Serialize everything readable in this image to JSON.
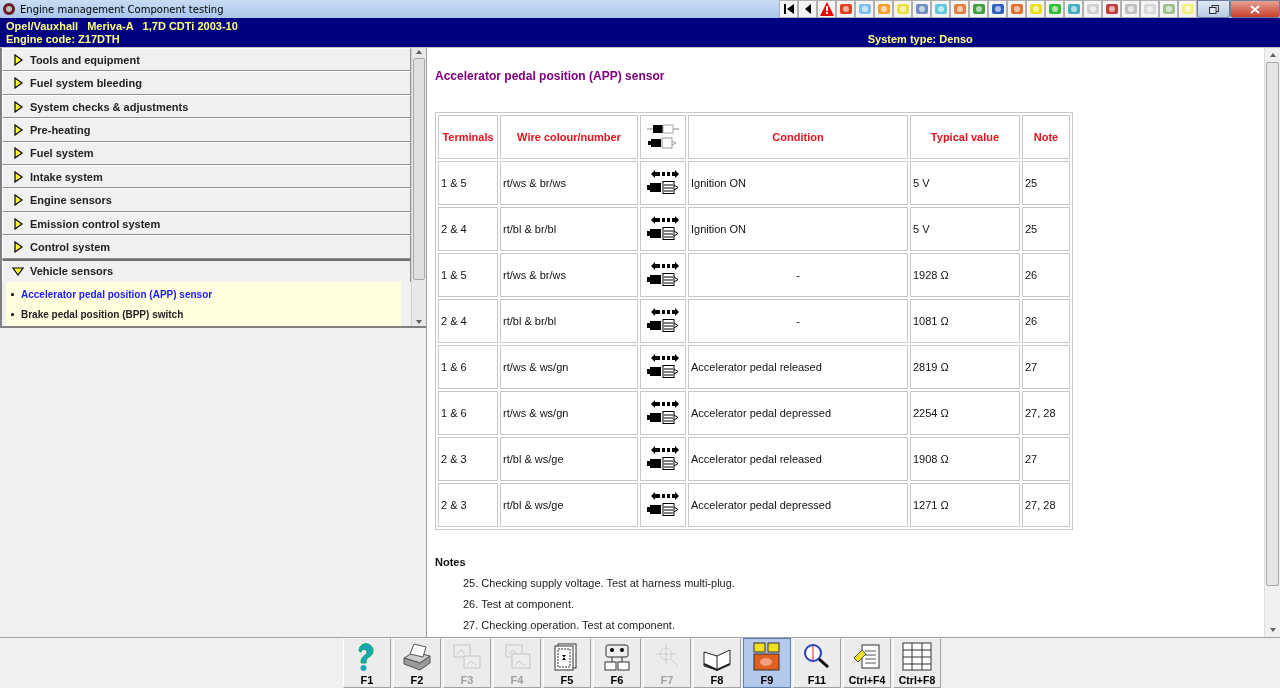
{
  "window": {
    "title": "Engine management Component testing"
  },
  "header": {
    "vehicle": [
      "Opel/Vauxhall",
      "Meriva-A",
      "1,7D CDTi 2003-10"
    ],
    "engine_code": "Engine code: Z17DTH",
    "system_type": "System type: Denso"
  },
  "sidebar": {
    "items": [
      {
        "label": "Tools and equipment",
        "expanded": false
      },
      {
        "label": "Fuel system bleeding",
        "expanded": false
      },
      {
        "label": "System checks & adjustments",
        "expanded": false
      },
      {
        "label": "Pre-heating",
        "expanded": false
      },
      {
        "label": "Fuel system",
        "expanded": false
      },
      {
        "label": "Intake system",
        "expanded": false
      },
      {
        "label": "Engine sensors",
        "expanded": false
      },
      {
        "label": "Emission control system",
        "expanded": false
      },
      {
        "label": "Control system",
        "expanded": false
      },
      {
        "label": "Vehicle sensors",
        "expanded": true,
        "children": [
          {
            "label": "Accelerator pedal position (APP) sensor",
            "selected": true
          },
          {
            "label": "Brake pedal position (BPP) switch",
            "selected": false
          }
        ]
      }
    ]
  },
  "content": {
    "title": "Accelerator pedal position (APP) sensor",
    "table": {
      "columns": [
        "Terminals",
        "Wire colour/number",
        "Condition",
        "Typical value",
        "Note"
      ],
      "rows": [
        {
          "terminals": "1 & 5",
          "wire": "rt/ws & br/ws",
          "condition": "Ignition ON",
          "value": "5 V",
          "note": "25"
        },
        {
          "terminals": "2 & 4",
          "wire": "rt/bl & br/bl",
          "condition": "Ignition ON",
          "value": "5 V",
          "note": "25"
        },
        {
          "terminals": "1 & 5",
          "wire": "rt/ws & br/ws",
          "condition": "-",
          "value": "1928 Ω",
          "note": "26"
        },
        {
          "terminals": "2 & 4",
          "wire": "rt/bl & br/bl",
          "condition": "-",
          "value": "1081 Ω",
          "note": "26"
        },
        {
          "terminals": "1 & 6",
          "wire": "rt/ws & ws/gn",
          "condition": "Accelerator pedal released",
          "value": "2819 Ω",
          "note": "27"
        },
        {
          "terminals": "1 & 6",
          "wire": "rt/ws & ws/gn",
          "condition": "Accelerator pedal depressed",
          "value": "2254 Ω",
          "note": "27, 28"
        },
        {
          "terminals": "2 & 3",
          "wire": "rt/bl & ws/ge",
          "condition": "Accelerator pedal released",
          "value": "1908 Ω",
          "note": "27"
        },
        {
          "terminals": "2 & 3",
          "wire": "rt/bl & ws/ge",
          "condition": "Accelerator pedal depressed",
          "value": "1271 Ω",
          "note": "27, 28"
        }
      ]
    },
    "notes": {
      "heading": "Notes",
      "items": [
        "25. Checking supply voltage. Test at harness multi-plug.",
        "26. Test at component.",
        "27. Checking operation. Test at component."
      ]
    }
  },
  "function_keys": [
    {
      "label": "F1",
      "disabled": false,
      "selected": false
    },
    {
      "label": "F2",
      "disabled": false,
      "selected": false
    },
    {
      "label": "F3",
      "disabled": true,
      "selected": false
    },
    {
      "label": "F4",
      "disabled": true,
      "selected": false
    },
    {
      "label": "F5",
      "disabled": false,
      "selected": false
    },
    {
      "label": "F6",
      "disabled": false,
      "selected": false
    },
    {
      "label": "F7",
      "disabled": true,
      "selected": false
    },
    {
      "label": "F8",
      "disabled": false,
      "selected": false
    },
    {
      "label": "F9",
      "disabled": false,
      "selected": true
    },
    {
      "label": "F11",
      "disabled": false,
      "selected": false
    },
    {
      "label": "Ctrl+F4",
      "disabled": false,
      "selected": false
    },
    {
      "label": "Ctrl+F8",
      "disabled": false,
      "selected": false
    }
  ]
}
